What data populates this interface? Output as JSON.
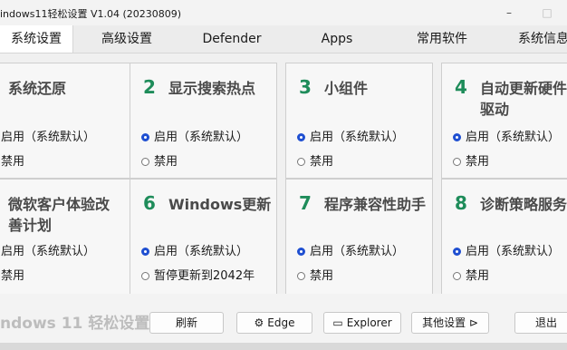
{
  "window": {
    "title": "indows11轻松设置 V1.04 (20230809)",
    "minimize_glyph": "–",
    "maximize_glyph": "□"
  },
  "tabs": [
    {
      "label": "系统设置",
      "active": true
    },
    {
      "label": "高级设置",
      "active": false
    },
    {
      "label": "Defender",
      "active": false
    },
    {
      "label": "Apps",
      "active": false
    },
    {
      "label": "常用软件",
      "active": false
    },
    {
      "label": "系统信息",
      "active": false
    }
  ],
  "cards": [
    {
      "num": "",
      "title": "系统还原",
      "options": [
        {
          "label": "启用（系统默认）",
          "selected": true
        },
        {
          "label": "禁用",
          "selected": false
        }
      ]
    },
    {
      "num": "2",
      "title": "显示搜索热点",
      "options": [
        {
          "label": "启用（系统默认）",
          "selected": true
        },
        {
          "label": "禁用",
          "selected": false
        }
      ]
    },
    {
      "num": "3",
      "title": "小组件",
      "options": [
        {
          "label": "启用（系统默认）",
          "selected": true
        },
        {
          "label": "禁用",
          "selected": false
        }
      ]
    },
    {
      "num": "4",
      "title": "自动更新硬件驱动",
      "options": [
        {
          "label": "启用（系统默认）",
          "selected": true
        },
        {
          "label": "禁用",
          "selected": false
        }
      ]
    },
    {
      "num": "",
      "title": "微软客户体验改善计划",
      "options": [
        {
          "label": "启用（系统默认）",
          "selected": true
        },
        {
          "label": "禁用",
          "selected": false
        }
      ]
    },
    {
      "num": "6",
      "title": "Windows更新",
      "options": [
        {
          "label": "启用（系统默认）",
          "selected": true
        },
        {
          "label": "暂停更新到2042年",
          "selected": false
        }
      ]
    },
    {
      "num": "7",
      "title": "程序兼容性助手",
      "options": [
        {
          "label": "启用（系统默认）",
          "selected": true
        },
        {
          "label": "禁用",
          "selected": false
        }
      ]
    },
    {
      "num": "8",
      "title": "诊断策略服务",
      "options": [
        {
          "label": "启用（系统默认）",
          "selected": true
        },
        {
          "label": "禁用",
          "selected": false
        }
      ]
    }
  ],
  "bottom": {
    "brand": "ndows 11 轻松设置",
    "refresh": "刷新",
    "edge_icon": "gear-icon",
    "edge": "Edge",
    "explorer_icon": "folder-icon",
    "explorer": "Explorer",
    "more": "其他设置 ⊳",
    "exit": "退出"
  },
  "colors": {
    "accent_number": "#1e8c5a",
    "radio_selected": "#1f4fd1"
  }
}
